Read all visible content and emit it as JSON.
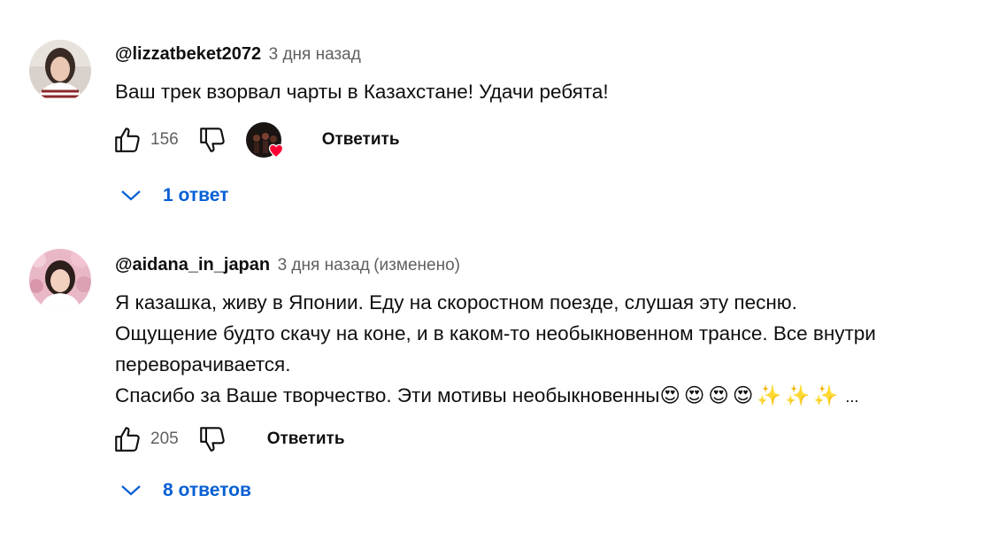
{
  "comments": [
    {
      "author": "@lizzatbeket2072",
      "time": "3 дня назад",
      "edited": "",
      "lines": [
        "Ваш трек взорвал чарты в Казахстане! Удачи ребята!"
      ],
      "likes": "156",
      "reply_label": "Ответить",
      "replies_label": "1 ответ",
      "creator_heart": true
    },
    {
      "author": "@aidana_in_japan",
      "time": "3 дня назад",
      "edited": "(изменено)",
      "lines": [
        "Я казашка, живу в Японии. Еду на скоростном поезде, слушая эту песню.",
        "Ощущение будто скачу на коне, и в каком-то необыкновенном трансе. Все внутри",
        "переворачивается.",
        "Спасибо за Ваше творчество. Эти мотивы необыкновенны"
      ],
      "emojis": "😍😍😍😍✨✨✨",
      "more": "...",
      "likes": "205",
      "reply_label": "Ответить",
      "replies_label": "8 ответов",
      "creator_heart": false
    }
  ],
  "icons": {
    "like": "thumb-up-icon",
    "dislike": "thumb-down-icon",
    "expand": "chevron-down-icon",
    "heart": "heart-icon"
  },
  "colors": {
    "link": "#065fd4",
    "secondary_text": "#606060",
    "heart": "#ff0033"
  }
}
